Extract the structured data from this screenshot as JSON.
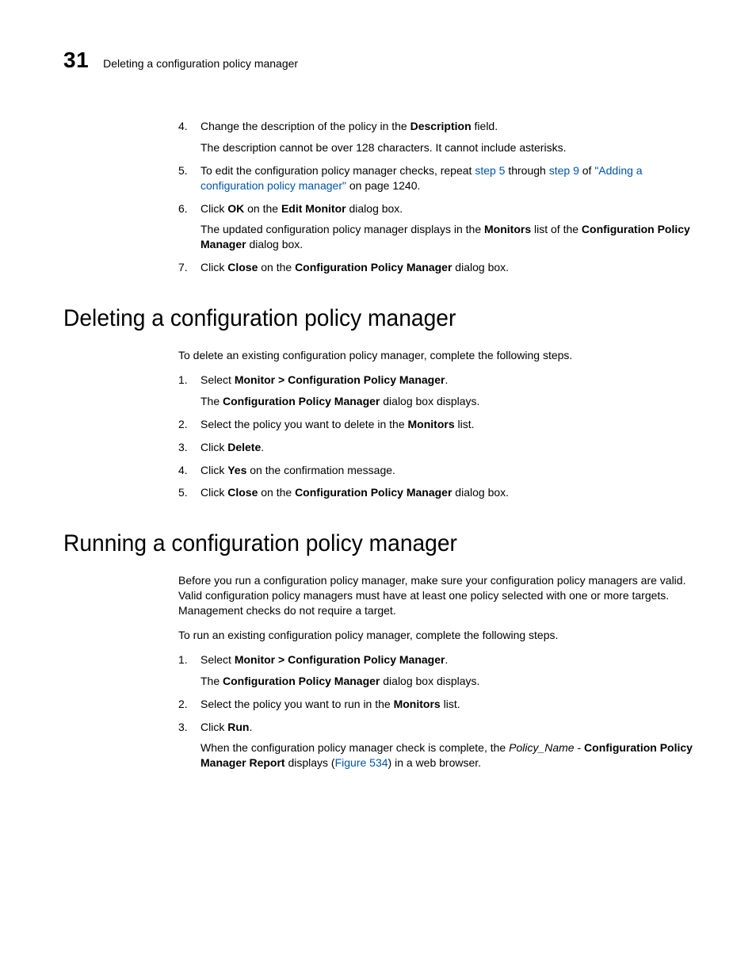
{
  "header": {
    "chapter_number": "31",
    "running_title": "Deleting a configuration policy manager"
  },
  "section0": {
    "steps": [
      {
        "num": "4.",
        "parts": [
          {
            "t": "Change the description of the policy in the "
          },
          {
            "t": "Description",
            "b": true
          },
          {
            "t": " field."
          }
        ],
        "sub": [
          {
            "t": "The description cannot be over 128 characters. It cannot include asterisks."
          }
        ]
      },
      {
        "num": "5.",
        "parts": [
          {
            "t": "To edit the configuration policy manager checks, repeat "
          },
          {
            "t": "step 5",
            "link": true
          },
          {
            "t": " through "
          },
          {
            "t": "step 9",
            "link": true
          },
          {
            "t": " of "
          },
          {
            "t": "\"Adding a configuration policy manager\"",
            "link": true
          },
          {
            "t": " on page 1240."
          }
        ]
      },
      {
        "num": "6.",
        "parts": [
          {
            "t": "Click "
          },
          {
            "t": "OK",
            "b": true
          },
          {
            "t": " on the "
          },
          {
            "t": "Edit Monitor",
            "b": true
          },
          {
            "t": " dialog box."
          }
        ],
        "sub": [
          {
            "t": "The updated configuration policy manager displays in the "
          },
          {
            "t": "Monitors",
            "b": true
          },
          {
            "t": " list of the "
          },
          {
            "t": "Configuration Policy Manager",
            "b": true
          },
          {
            "t": " dialog box."
          }
        ]
      },
      {
        "num": "7.",
        "parts": [
          {
            "t": "Click "
          },
          {
            "t": "Close",
            "b": true
          },
          {
            "t": " on the "
          },
          {
            "t": "Configuration Policy Manager",
            "b": true
          },
          {
            "t": " dialog box."
          }
        ]
      }
    ]
  },
  "section1": {
    "heading": "Deleting a configuration policy manager",
    "intro": "To delete an existing configuration policy manager, complete the following steps.",
    "steps": [
      {
        "num": "1.",
        "parts": [
          {
            "t": "Select "
          },
          {
            "t": "Monitor > Configuration Policy Manager",
            "b": true
          },
          {
            "t": "."
          }
        ],
        "sub": [
          {
            "t": "The "
          },
          {
            "t": "Configuration Policy Manager",
            "b": true
          },
          {
            "t": " dialog box displays."
          }
        ]
      },
      {
        "num": "2.",
        "parts": [
          {
            "t": "Select the policy you want to delete in the "
          },
          {
            "t": "Monitors",
            "b": true
          },
          {
            "t": " list."
          }
        ]
      },
      {
        "num": "3.",
        "parts": [
          {
            "t": "Click "
          },
          {
            "t": "Delete",
            "b": true
          },
          {
            "t": "."
          }
        ]
      },
      {
        "num": "4.",
        "parts": [
          {
            "t": "Click "
          },
          {
            "t": "Yes",
            "b": true
          },
          {
            "t": " on the confirmation message."
          }
        ]
      },
      {
        "num": "5.",
        "parts": [
          {
            "t": "Click "
          },
          {
            "t": "Close",
            "b": true
          },
          {
            "t": " on the "
          },
          {
            "t": "Configuration Policy Manager",
            "b": true
          },
          {
            "t": " dialog box."
          }
        ]
      }
    ]
  },
  "section2": {
    "heading": "Running a configuration policy manager",
    "intro1": "Before you run a configuration policy manager, make sure your configuration policy managers are valid. Valid configuration policy managers must have at least one policy selected with one or more targets. Management checks do not require a target.",
    "intro2": "To run an existing configuration policy manager, complete the following steps.",
    "steps": [
      {
        "num": "1.",
        "parts": [
          {
            "t": "Select "
          },
          {
            "t": "Monitor > Configuration Policy Manager",
            "b": true
          },
          {
            "t": "."
          }
        ],
        "sub": [
          {
            "t": "The "
          },
          {
            "t": "Configuration Policy Manager",
            "b": true
          },
          {
            "t": " dialog box displays."
          }
        ]
      },
      {
        "num": "2.",
        "parts": [
          {
            "t": "Select the policy you want to run in the "
          },
          {
            "t": "Monitors",
            "b": true
          },
          {
            "t": " list."
          }
        ]
      },
      {
        "num": "3.",
        "parts": [
          {
            "t": "Click "
          },
          {
            "t": "Run",
            "b": true
          },
          {
            "t": "."
          }
        ],
        "sub": [
          {
            "t": "When the configuration policy manager check is complete, the "
          },
          {
            "t": "Policy_Name",
            "i": true
          },
          {
            "t": " - "
          },
          {
            "t": "Configuration Policy Manager Report",
            "b": true
          },
          {
            "t": " displays ("
          },
          {
            "t": "Figure 534",
            "link": true
          },
          {
            "t": ") in a web browser."
          }
        ]
      }
    ]
  }
}
